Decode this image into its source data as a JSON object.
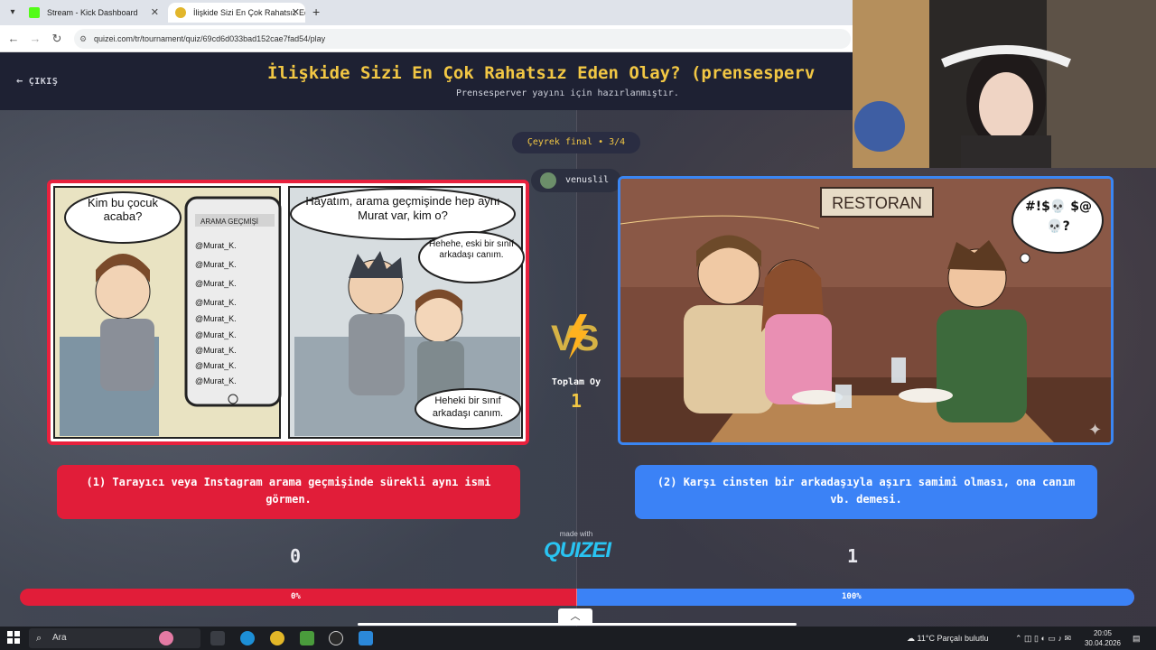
{
  "browser": {
    "tabs": [
      {
        "label": "Stream - Kick Dashboard"
      },
      {
        "label": "İlişkide Sizi En Çok Rahatsız Ede"
      }
    ],
    "url": "quizei.com/tr/tournament/quiz/69cd6d033bad152cae7fad54/play"
  },
  "header": {
    "exit_label": "ÇIKIŞ",
    "title": "İlişkide Sizi En Çok Rahatsız Eden Olay? (prensesperv",
    "subtitle": "Prensesperver yayını için hazırlanmıştır."
  },
  "round_label": "Çeyrek final • 3/4",
  "user_chip": "venuslil",
  "left_card": {
    "bubble1": "Kim bu çocuk acaba?",
    "phone_header": "ARAMA GEÇMİŞİ",
    "phone_items": [
      "@Murat_K.",
      "@Murat_K.",
      "@Murat_K.",
      "@Murat_K.",
      "@Murat_K.",
      "@Murat_K.",
      "@Murat_K.",
      "@Murat_K.",
      "@Murat_K."
    ],
    "bubble2": "Hayatım, arama geçmişinde hep aynı Murat var, kim o?",
    "bubble3": "Hehehe, eski bir sınıf arkadaşı canım.",
    "bubble4": "Heheki bir sınıf arkadaşı canım."
  },
  "right_card": {
    "sign": "RESTORAN",
    "curse_bubble": "#!$💀 $@💀?"
  },
  "total": {
    "label": "Toplam Oy",
    "value": "1"
  },
  "options": [
    {
      "text": "(1) Tarayıcı veya Instagram arama geçmişinde sürekli aynı ismi görmen.",
      "score": "0",
      "percent_label": "0%",
      "percent": 0,
      "color": "#e11d39"
    },
    {
      "text": "(2) Karşı cinsten bir arkadaşıyla aşırı samimi olması, ona canım vb. demesi.",
      "score": "1",
      "percent_label": "100%",
      "percent": 100,
      "color": "#3b82f6"
    }
  ],
  "branding": {
    "made_with": "made with",
    "brand": "QUIZEI"
  },
  "taskbar": {
    "search_placeholder": "Ara",
    "weather": "11°C  Parçalı bulutlu",
    "time": "20:05",
    "date": "30.04.2026"
  }
}
